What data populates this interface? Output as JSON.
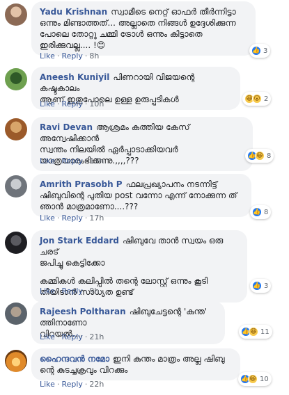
{
  "actions": {
    "like": "Like",
    "reply": "Reply",
    "sep": "·"
  },
  "comments": [
    {
      "author": "Yadu Krishnan",
      "lines": [
        "സ്വാമീടെ നെറ്റ് ഓഫർ തീർന്നിട്ടാ",
        "ഒന്നും മിണ്ടാത്തത്... അല്ലാതെ നിങ്ങൾ ഉദ്ദേശിക്കുന്ന",
        "പോലെ തോറ്റു ചമ്മി ട്രോൾ ഒന്നും കിട്ടാതെ",
        "ഇരിക്കുവല്ല.... !😊"
      ],
      "time": "8h",
      "reaction_icons": [
        "like-icon"
      ],
      "reaction_count": "3",
      "avatar_color": "#c8a48c"
    },
    {
      "author": "Aneesh Kuniyil",
      "lines": [
        "പിണറായി വിജയന്റെ കഷ്ടകാലം",
        "ആണ് ഇതുപോലെ ഉള്ള ഉരുപ്പടികൾ"
      ],
      "time": "10h",
      "reaction_icons": [
        "haha-icon",
        "wow-icon"
      ],
      "reaction_count": "2",
      "avatar_color": "#4a7a3a"
    },
    {
      "author": "Ravi Devan",
      "lines": [
        "ആശ്രമം കത്തിയ കേസ് അന്വേഷിക്കാൻ",
        "സ്വന്തം നിലയിൽ ഏർപ്പാടാക്കിയവർ",
        "യാത്രയാരംഭിക്കുന്നു.,,,,???"
      ],
      "time": "13h",
      "reaction_icons": [
        "like-icon",
        "haha-icon"
      ],
      "reaction_count": "8",
      "avatar_color": "#b07040"
    },
    {
      "author": "Amrith Prasobh P",
      "lines": [
        "ഫലപ്രഖ്യാപനം നടന്നിട്ട്",
        "ഷിബുവിന്റെ പുതിയ post വന്നോ എന്ന് നോക്കുന്ന ത്",
        "ഞാൻ മാത്രമാണോ....???"
      ],
      "time": "17h",
      "reaction_icons": [
        "like-icon"
      ],
      "reaction_count": "8",
      "avatar_color": "#8a8f96"
    },
    {
      "author": "Jon Stark Eddard",
      "lines": [
        "ഷിബുവേ താൻ സ്വയം ഒരു ചരട്",
        "ജപിച്ചു കെട്ടിക്കോ",
        "",
        "കമ്മികൾ കലിപ്പിൽ തന്റെ ലോസ്റ്റ് ഒന്നും കൂടി",
        "തീയിടാൻ സാധ്യത ഉണ്ട്"
      ],
      "time": "9h",
      "reaction_icons": [
        "like-icon"
      ],
      "reaction_count": "3",
      "avatar_color": "#3a3a40"
    },
    {
      "author": "Rajeesh Poltharan",
      "lines": [
        "ഷിബുചേട്ടന്റെ 'കുന്ത' ത്തിനാണോ",
        "വിറയൽ...."
      ],
      "time": "21h",
      "reaction_icons": [
        "like-icon",
        "haha-icon"
      ],
      "reaction_count": "11",
      "avatar_color": "#707880"
    },
    {
      "author": "ഹൈന്ദവൻ നമോ",
      "lines": [
        "ഇനി കുന്തം മാത്രം അല്ല ഷിബു",
        "ന്റെ കുടച്ചക്രവും വിറക്കും"
      ],
      "time": "22h",
      "reaction_icons": [
        "like-icon",
        "haha-icon"
      ],
      "reaction_count": "10",
      "avatar_color": "#d08a30"
    }
  ]
}
